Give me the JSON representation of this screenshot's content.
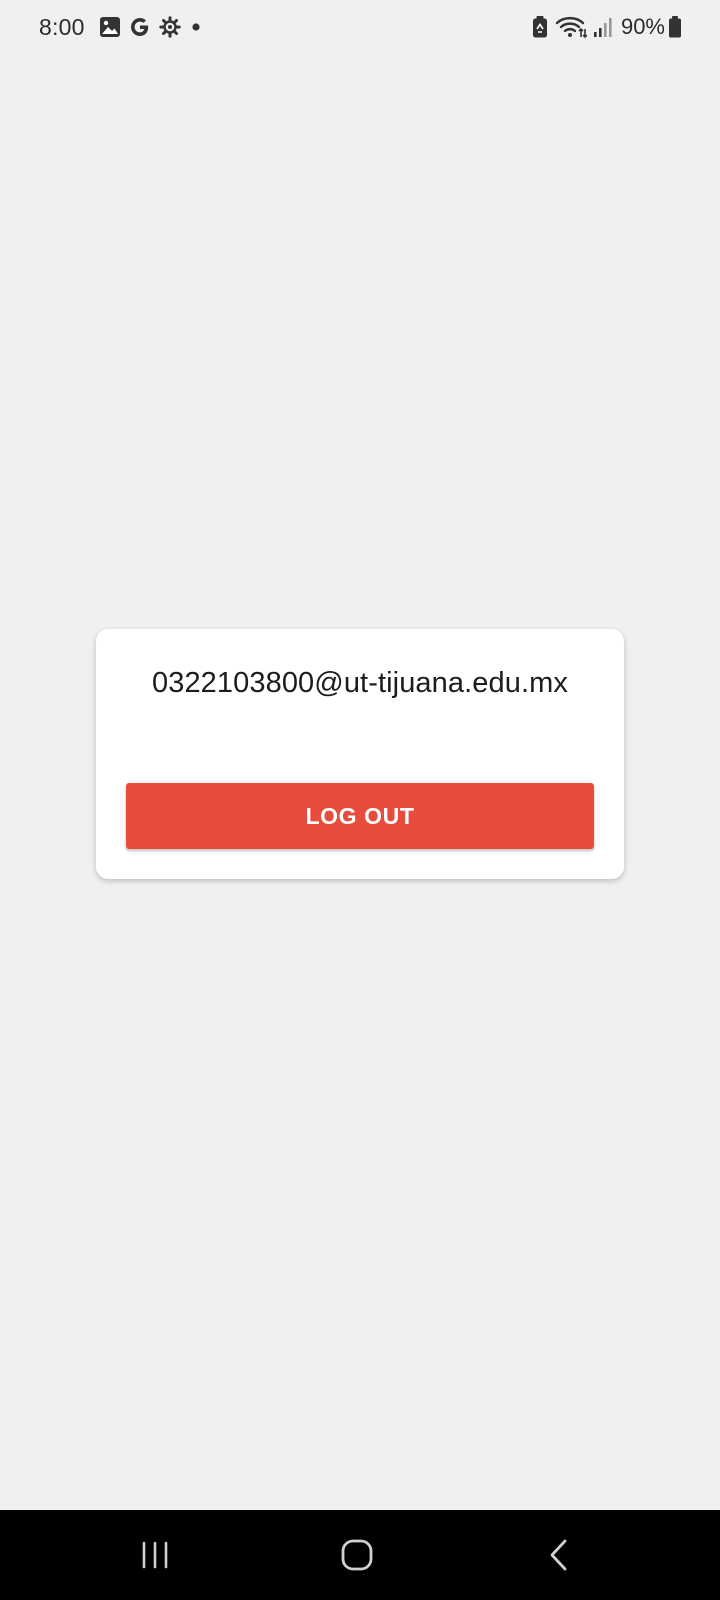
{
  "status_bar": {
    "time": "8:00",
    "left_icons": [
      "gallery-icon",
      "google-icon",
      "settings-icon",
      "notification-dot-icon"
    ],
    "right_icons": [
      "battery-saver-icon",
      "wifi-icon",
      "signal-icon",
      "battery-icon"
    ],
    "battery_percent": "90%"
  },
  "card": {
    "email": "0322103800@ut-tijuana.edu.mx",
    "logout_label": "LOG OUT"
  },
  "nav_bar": {
    "buttons": [
      "recents-icon",
      "home-icon",
      "back-icon"
    ]
  },
  "colors": {
    "background": "#f0f0f0",
    "card": "#ffffff",
    "logout_button": "#e74c3c",
    "nav_bar": "#000000"
  }
}
